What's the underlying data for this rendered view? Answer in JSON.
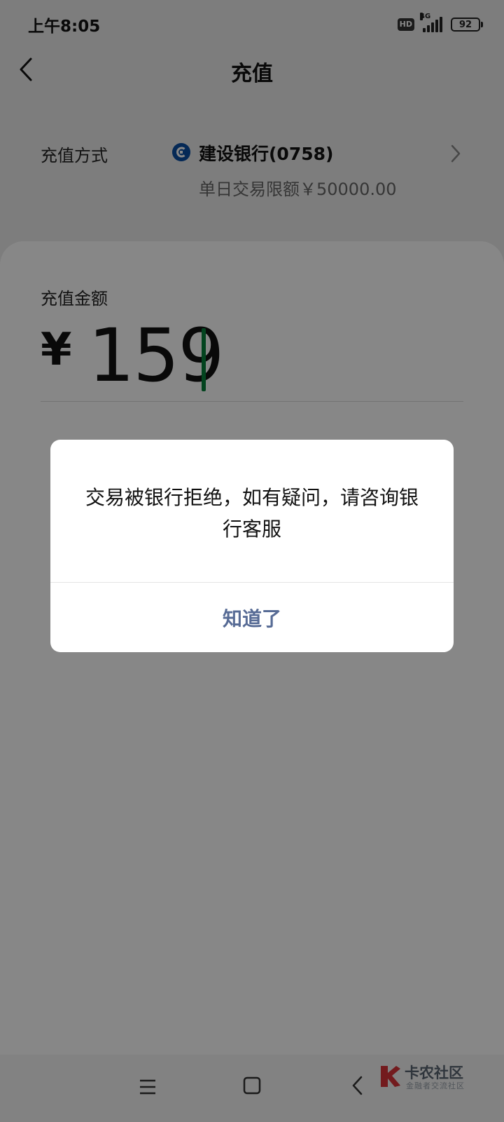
{
  "status_bar": {
    "time": "上午8:05",
    "hd_badge": "HD",
    "network": "4G",
    "battery_level": "92"
  },
  "nav": {
    "title": "充值",
    "back_icon": "chevron-left-icon"
  },
  "payment_method": {
    "label": "充值方式",
    "bank_name": "建设银行(0758)",
    "daily_limit": "单日交易限额￥50000.00",
    "bank_logo_icon": "ccb-bank-logo",
    "chevron_icon": "chevron-right-icon"
  },
  "amount": {
    "label": "充值金额",
    "currency": "¥",
    "value": "159",
    "caret_color": "#07803c"
  },
  "dialog": {
    "message": "交易被银行拒绝，如有疑问，请咨询银行客服",
    "button_label": "知道了",
    "button_color": "#576b95"
  },
  "system_nav": {
    "menu_icon": "menu-icon",
    "home_icon": "home-icon",
    "back_icon": "back-icon"
  },
  "watermark": {
    "title": "卡农社区",
    "subtitle": "金融者交流社区"
  }
}
